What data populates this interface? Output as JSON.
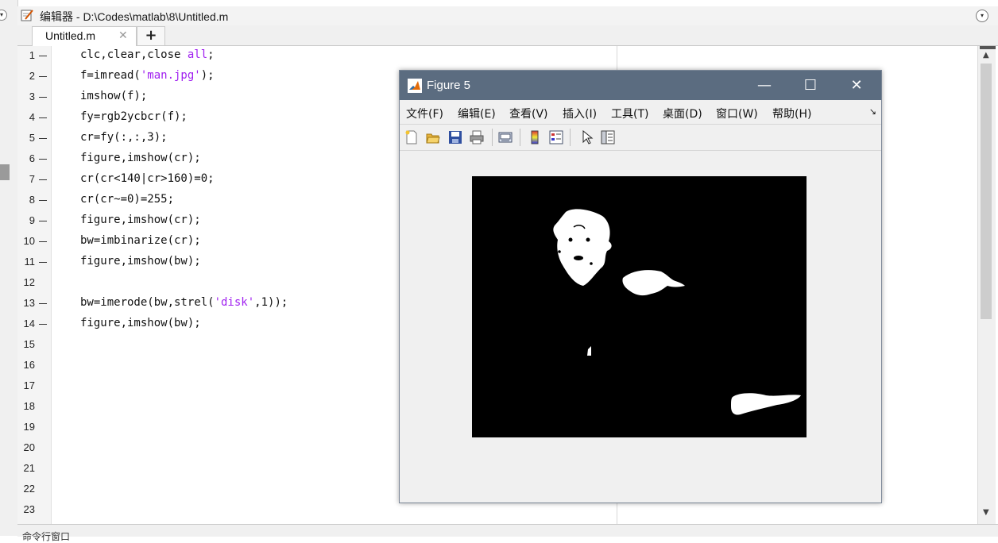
{
  "editor": {
    "title": "编辑器 - D:\\Codes\\matlab\\8\\Untitled.m",
    "tab_label": "Untitled.m",
    "tab_close": "✕",
    "tab_add": "+"
  },
  "code": {
    "line_numbers": [
      "1",
      "2",
      "3",
      "4",
      "5",
      "6",
      "7",
      "8",
      "9",
      "10",
      "11",
      "12",
      "13",
      "14",
      "15",
      "16",
      "17",
      "18",
      "19",
      "20",
      "21",
      "22",
      "23"
    ],
    "lines": [
      "clc,clear,close all;",
      "f=imread('man.jpg');",
      "imshow(f);",
      "fy=rgb2ycbcr(f);",
      "cr=fy(:,:,3);",
      "figure,imshow(cr);",
      "cr(cr<140|cr>160)=0;",
      "cr(cr~=0)=255;",
      "figure,imshow(cr);",
      "bw=imbinarize(cr);",
      "figure,imshow(bw);",
      "",
      "bw=imerode(bw,strel('disk',1));",
      "figure,imshow(bw);"
    ],
    "line1_pre": "clc,clear,close ",
    "line1_str": "all",
    "line1_post": ";",
    "line2_pre": "f=imread(",
    "line2_str": "'man.jpg'",
    "line2_post": ");",
    "line13_pre": "bw=imerode(bw,strel(",
    "line13_str": "'disk'",
    "line13_post": ",1));"
  },
  "command_window": {
    "label": "命令行窗口"
  },
  "figure": {
    "title": "Figure 5",
    "menus": [
      "文件(F)",
      "编辑(E)",
      "查看(V)",
      "插入(I)",
      "工具(T)",
      "桌面(D)",
      "窗口(W)",
      "帮助(H)"
    ],
    "menu_corner": "↘",
    "toolbar_icons": [
      "new-figure-icon",
      "open-file-icon",
      "save-icon",
      "print-icon",
      "link-plot-icon",
      "colorbar-icon",
      "legend-icon",
      "pointer-icon",
      "property-editor-icon"
    ],
    "window_buttons": {
      "minimize": "—",
      "maximize": "☐",
      "close": "✕"
    }
  },
  "colors": {
    "string": "#a020f0",
    "figure_titlebar": "#5b6c80",
    "axes_background": "#000000"
  }
}
